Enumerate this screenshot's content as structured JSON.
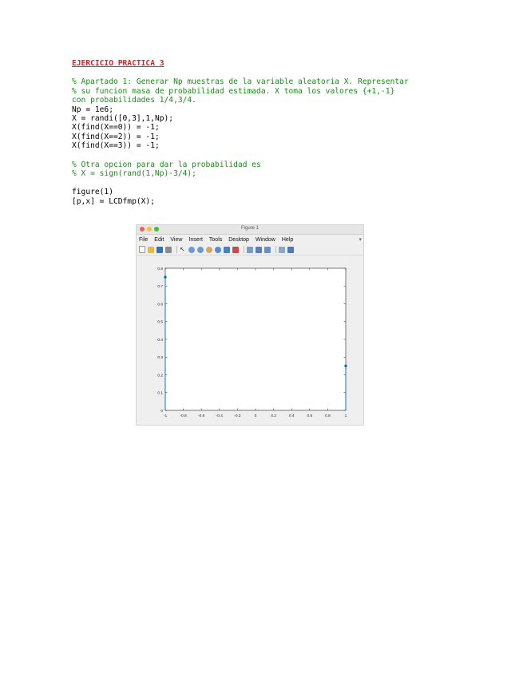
{
  "document": {
    "title": "EJERCICIO PRACTICA 3",
    "block1_comments": [
      "% Apartado 1: Generar Np muestras de la variable aleatoria X. Representar",
      "% su funcion masa de probabilidad estimada. X toma los valores {+1,-1}",
      "con probabilidades 1/4,3/4."
    ],
    "block1_code": [
      "Np = 1e6;",
      "X = randi([0,3],1,Np);",
      "X(find(X==0)) = -1;",
      "X(find(X==2)) = -1;",
      "X(find(X==3)) = -1;"
    ],
    "block2_comments": [
      "% Otra opcion para dar la probabilidad es",
      "% X = sign(rand(1,Np)-3/4);"
    ],
    "block3_code": [
      "figure(1)",
      "[p,x] = LCDfmp(X);"
    ]
  },
  "figure_window": {
    "title": "Figure 1",
    "menus": [
      "File",
      "Edit",
      "View",
      "Insert",
      "Tools",
      "Desktop",
      "Window",
      "Help"
    ],
    "toolbar_icons": [
      "new-file-icon",
      "open-folder-icon",
      "save-icon",
      "print-icon",
      "pointer-icon",
      "zoom-in-icon",
      "zoom-out-icon",
      "pan-icon",
      "rotate-icon",
      "data-cursor-icon",
      "brush-icon",
      "link-plot-icon",
      "colorbar-icon",
      "legend-icon",
      "hide-plot-tools-icon",
      "show-plot-tools-icon"
    ],
    "colors": {
      "red": "#f25f58",
      "yellow": "#f9bd2f",
      "green": "#3cc13f",
      "series": "#0072bd"
    }
  },
  "chart_data": {
    "type": "scatter",
    "title": "",
    "xlabel": "",
    "ylabel": "",
    "x": [
      -1,
      1
    ],
    "y": [
      0.75,
      0.25
    ],
    "stems": true,
    "xlim": [
      -1,
      1
    ],
    "ylim": [
      0,
      0.8
    ],
    "xticks": [
      "-1",
      "-0.8",
      "-0.6",
      "-0.4",
      "-0.2",
      "0",
      "0.2",
      "0.4",
      "0.6",
      "0.8",
      "1"
    ],
    "yticks": [
      "0",
      "0.1",
      "0.2",
      "0.3",
      "0.4",
      "0.5",
      "0.6",
      "0.7",
      "0.8"
    ],
    "grid": false,
    "box": true
  }
}
